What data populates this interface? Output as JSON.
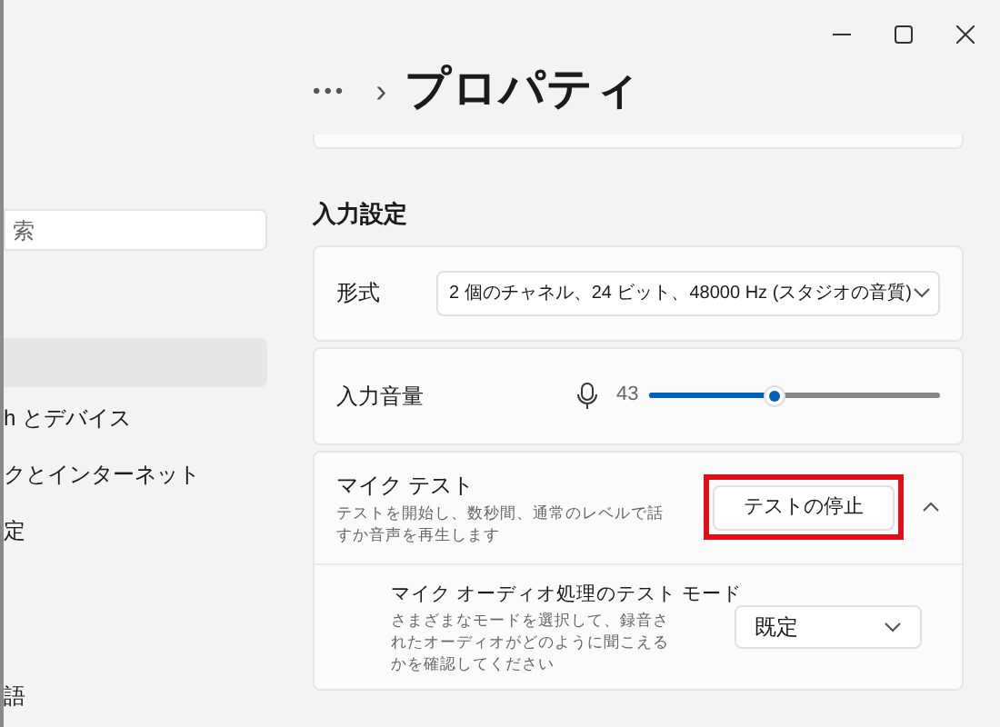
{
  "sidebar": {
    "search": {
      "placeholder": "索"
    },
    "items": [
      {
        "selected": true
      },
      {
        "label": "h とデバイス",
        "selected": false
      },
      {
        "label": "クとインターネット",
        "selected": false
      },
      {
        "label": "定",
        "selected": false
      },
      {
        "label": "語",
        "selected": false
      }
    ]
  },
  "breadcrumb": {
    "overflow": "•••",
    "separator": "›",
    "title": "プロパティ"
  },
  "section_title": "入力設定",
  "format": {
    "label": "形式",
    "value": "2 個のチャネル、24 ビット、48000 Hz (スタジオの音質)"
  },
  "volume": {
    "label": "入力音量",
    "reading": "43",
    "level": 0.43
  },
  "mic_test": {
    "title": "マイク テスト",
    "description": "テストを開始し、数秒間、通常のレベルで話すか音声を再生します",
    "button": "テストの停止",
    "highlighted": true,
    "expanded": true,
    "mode": {
      "title": "マイク オーディオ処理のテスト モード",
      "description": "さまざまなモードを選択して、録音されたオーディオがどのように聞こえるかを確認してください",
      "value": "既定"
    }
  }
}
